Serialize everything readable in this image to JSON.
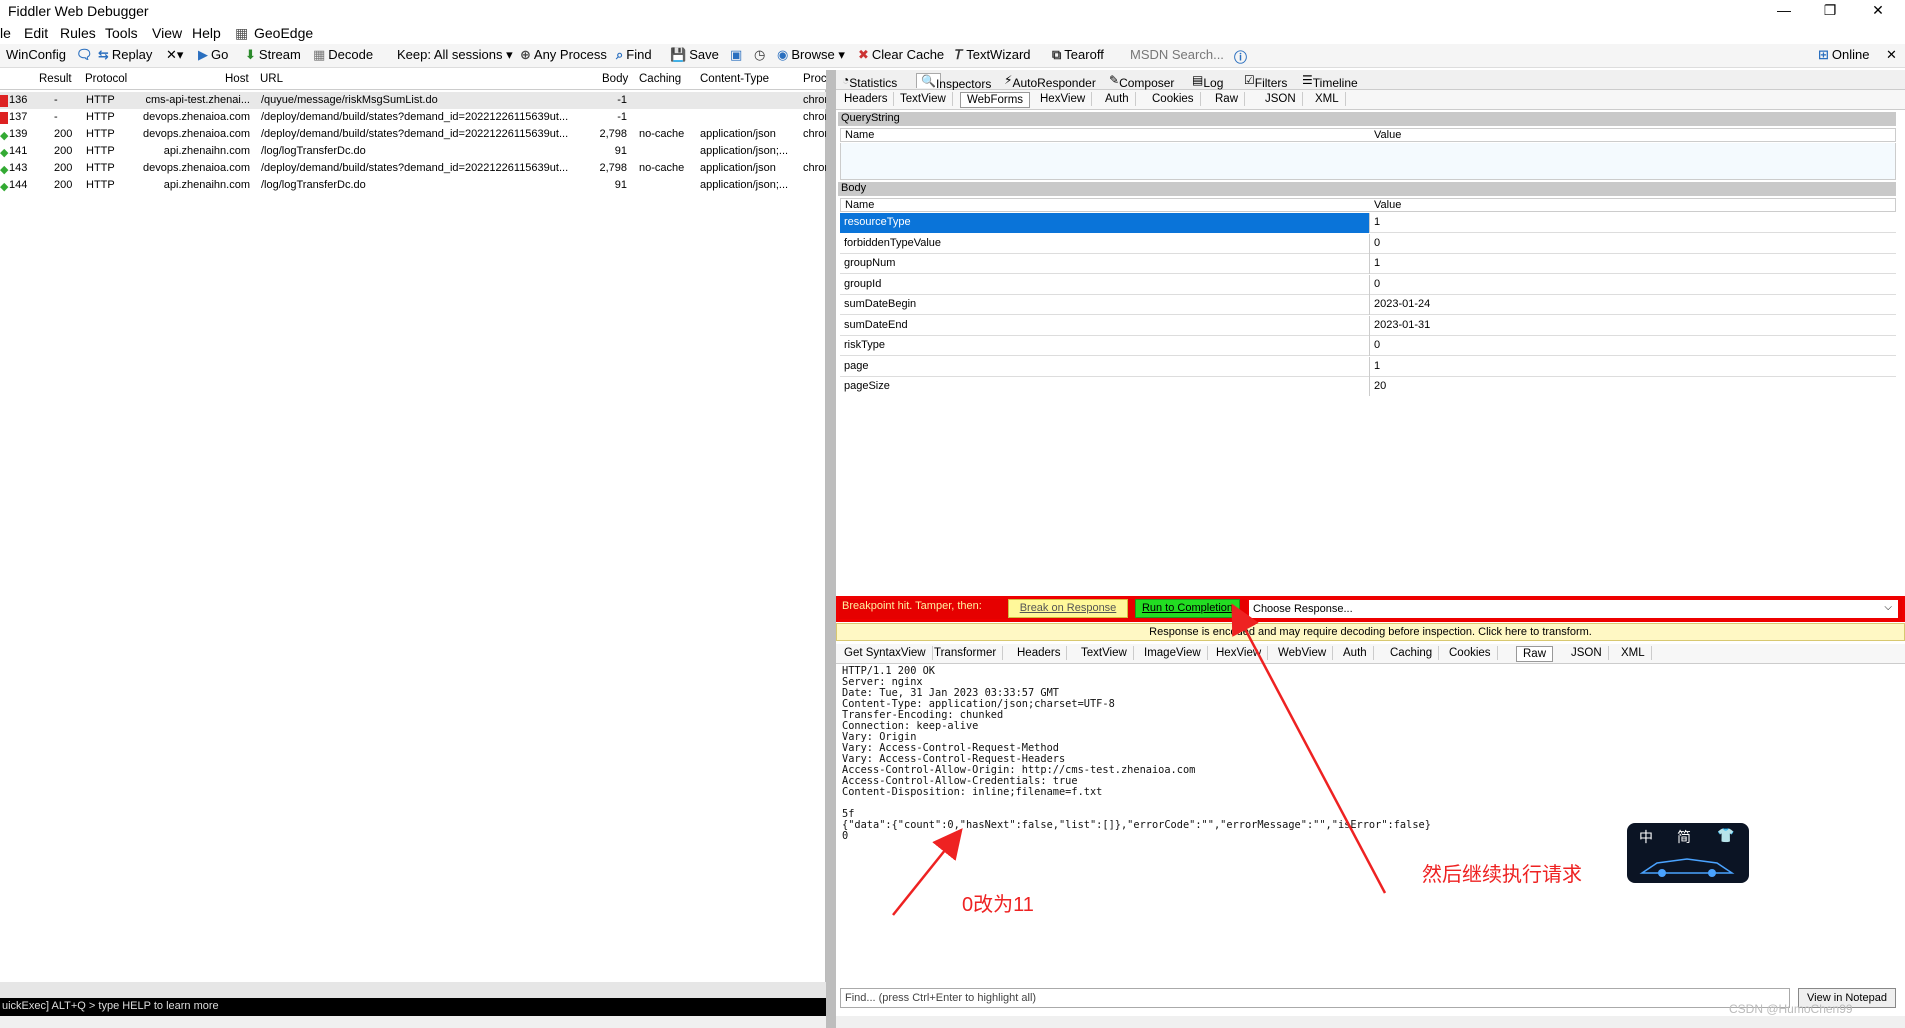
{
  "window": {
    "title": "Fiddler Web Debugger",
    "controls": [
      "—",
      "❐",
      "✕"
    ]
  },
  "menu": [
    "le",
    "Edit",
    "Rules",
    "Tools",
    "View",
    "Help",
    "GeoEdge"
  ],
  "toolbar": {
    "winconfig": "WinConfig",
    "replay": "Replay",
    "go": "Go",
    "stream": "Stream",
    "decode": "Decode",
    "keep": "Keep: All sessions",
    "anyprocess": "Any Process",
    "find": "Find",
    "save": "Save",
    "browse": "Browse",
    "clearcache": "Clear Cache",
    "textwizard": "TextWizard",
    "tearoff": "Tearoff",
    "msdn": "MSDN Search...",
    "online": "Online"
  },
  "sessions": {
    "headers": [
      "Result",
      "Protocol",
      "Host",
      "URL",
      "Body",
      "Caching",
      "Content-Type",
      "Proce"
    ],
    "rows": [
      {
        "id": "136",
        "result": "-",
        "protocol": "HTTP",
        "host": "cms-api-test.zhenai...",
        "url": "/quyue/message/riskMsgSumList.do",
        "body": "-1",
        "caching": "",
        "ctype": "",
        "proc": "chror"
      },
      {
        "id": "137",
        "result": "-",
        "protocol": "HTTP",
        "host": "devops.zhenaioa.com",
        "url": "/deploy/demand/build/states?demand_id=20221226115639ut...",
        "body": "-1",
        "caching": "",
        "ctype": "",
        "proc": "chror"
      },
      {
        "id": "139",
        "result": "200",
        "protocol": "HTTP",
        "host": "devops.zhenaioa.com",
        "url": "/deploy/demand/build/states?demand_id=20221226115639ut...",
        "body": "2,798",
        "caching": "no-cache",
        "ctype": "application/json",
        "proc": "chror"
      },
      {
        "id": "141",
        "result": "200",
        "protocol": "HTTP",
        "host": "api.zhenaihn.com",
        "url": "/log/logTransferDc.do",
        "body": "91",
        "caching": "",
        "ctype": "application/json;...",
        "proc": ""
      },
      {
        "id": "143",
        "result": "200",
        "protocol": "HTTP",
        "host": "devops.zhenaioa.com",
        "url": "/deploy/demand/build/states?demand_id=20221226115639ut...",
        "body": "2,798",
        "caching": "no-cache",
        "ctype": "application/json",
        "proc": "chror"
      },
      {
        "id": "144",
        "result": "200",
        "protocol": "HTTP",
        "host": "api.zhenaihn.com",
        "url": "/log/logTransferDc.do",
        "body": "91",
        "caching": "",
        "ctype": "application/json;...",
        "proc": ""
      }
    ]
  },
  "quickexec": "uickExec] ALT+Q > type HELP to learn more",
  "main_tabs": [
    "Statistics",
    "Inspectors",
    "AutoResponder",
    "Composer",
    "Log",
    "Filters",
    "Timeline"
  ],
  "request_tabs": [
    "Headers",
    "TextView",
    "WebForms",
    "HexView",
    "Auth",
    "Cookies",
    "Raw",
    "JSON",
    "XML"
  ],
  "querystring": {
    "title": "QueryString",
    "col_name": "Name",
    "col_value": "Value"
  },
  "body": {
    "title": "Body",
    "col_name": "Name",
    "col_value": "Value",
    "rows": [
      {
        "name": "resourceType",
        "value": "1"
      },
      {
        "name": "forbiddenTypeValue",
        "value": "0"
      },
      {
        "name": "groupNum",
        "value": "1"
      },
      {
        "name": "groupId",
        "value": "0"
      },
      {
        "name": "sumDateBegin",
        "value": "2023-01-24"
      },
      {
        "name": "sumDateEnd",
        "value": "2023-01-31"
      },
      {
        "name": "riskType",
        "value": "0"
      },
      {
        "name": "page",
        "value": "1"
      },
      {
        "name": "pageSize",
        "value": "20"
      }
    ]
  },
  "breakpoint": {
    "label": "Breakpoint hit. Tamper, then:",
    "break_on_response": "Break on Response",
    "run_to_completion": "Run to Completion",
    "choose_response": "Choose Response...",
    "encoded_notice": "Response is encoded and may require decoding before inspection. Click here to transform."
  },
  "response_tabs": [
    "Get SyntaxView",
    "Transformer",
    "Headers",
    "TextView",
    "ImageView",
    "HexView",
    "WebView",
    "Auth",
    "Caching",
    "Cookies",
    "Raw",
    "JSON",
    "XML"
  ],
  "raw_response": "HTTP/1.1 200 OK\nServer: nginx\nDate: Tue, 31 Jan 2023 03:33:57 GMT\nContent-Type: application/json;charset=UTF-8\nTransfer-Encoding: chunked\nConnection: keep-alive\nVary: Origin\nVary: Access-Control-Request-Method\nVary: Access-Control-Request-Headers\nAccess-Control-Allow-Origin: http://cms-test.zhenaioa.com\nAccess-Control-Allow-Credentials: true\nContent-Disposition: inline;filename=f.txt\n\n5f\n{\"data\":{\"count\":0,\"hasNext\":false,\"list\":[]},\"errorCode\":\"\",\"errorMessage\":\"\",\"isError\":false}\n0",
  "find_placeholder": "Find... (press Ctrl+Enter to highlight all)",
  "view_in_notepad": "View in Notepad",
  "annotations": {
    "note1": "0改为11",
    "note2": "然后继续执行请求",
    "color": "#ee2222"
  },
  "logo_chars": [
    "中",
    "简",
    "👕"
  ],
  "watermark": "CSDN @HumoChen99",
  "colors": {
    "breakpoint_red": "#e60000",
    "selection_blue": "#0a74d9",
    "run_green": "#22dd22",
    "break_yellow": "#fff89a"
  }
}
